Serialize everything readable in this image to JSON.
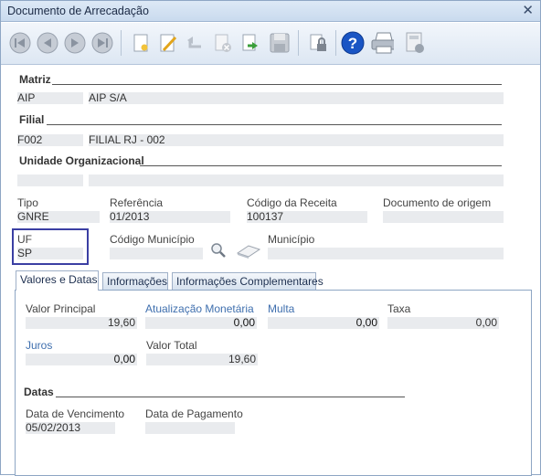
{
  "window": {
    "title": "Documento de Arrecadação"
  },
  "toolbar": {
    "icons": [
      "first-icon",
      "prev-icon",
      "next-icon",
      "last-icon",
      "new-icon",
      "edit-icon",
      "undo-icon",
      "delete-icon",
      "export-icon",
      "save-icon",
      "lock-icon",
      "help-icon",
      "print-icon",
      "calculator-icon"
    ]
  },
  "matriz": {
    "label": "Matriz",
    "code": "AIP",
    "name": "AIP S/A"
  },
  "filial": {
    "label": "Filial",
    "code": "F002",
    "name": "FILIAL RJ - 002"
  },
  "unidade": {
    "label": "Unidade Organizacional",
    "code": "",
    "name": ""
  },
  "fields": {
    "tipo": {
      "label": "Tipo",
      "value": "GNRE"
    },
    "referencia": {
      "label": "Referência",
      "value": "01/2013"
    },
    "codigo_receita": {
      "label": "Código da Receita",
      "value": "100137"
    },
    "documento_origem": {
      "label": "Documento de origem",
      "value": ""
    },
    "uf": {
      "label": "UF",
      "value": "SP"
    },
    "codigo_municipio": {
      "label": "Código Município",
      "value": ""
    },
    "municipio": {
      "label": "Município",
      "value": ""
    }
  },
  "tabs": [
    "Valores e Datas",
    "Informações",
    "Informações Complementares"
  ],
  "valores": {
    "valor_principal": {
      "label": "Valor Principal",
      "value": "19,60"
    },
    "atualizacao": {
      "label": "Atualização Monetária",
      "value": "0,00"
    },
    "multa": {
      "label": "Multa",
      "value": "0,00"
    },
    "taxa": {
      "label": "Taxa",
      "value": "0,00"
    },
    "juros": {
      "label": "Juros",
      "value": "0,00"
    },
    "valor_total": {
      "label": "Valor Total",
      "value": "19,60"
    }
  },
  "datas": {
    "label": "Datas",
    "vencimento": {
      "label": "Data de Vencimento",
      "value": "05/02/2013"
    },
    "pagamento": {
      "label": "Data de Pagamento",
      "value": ""
    }
  }
}
